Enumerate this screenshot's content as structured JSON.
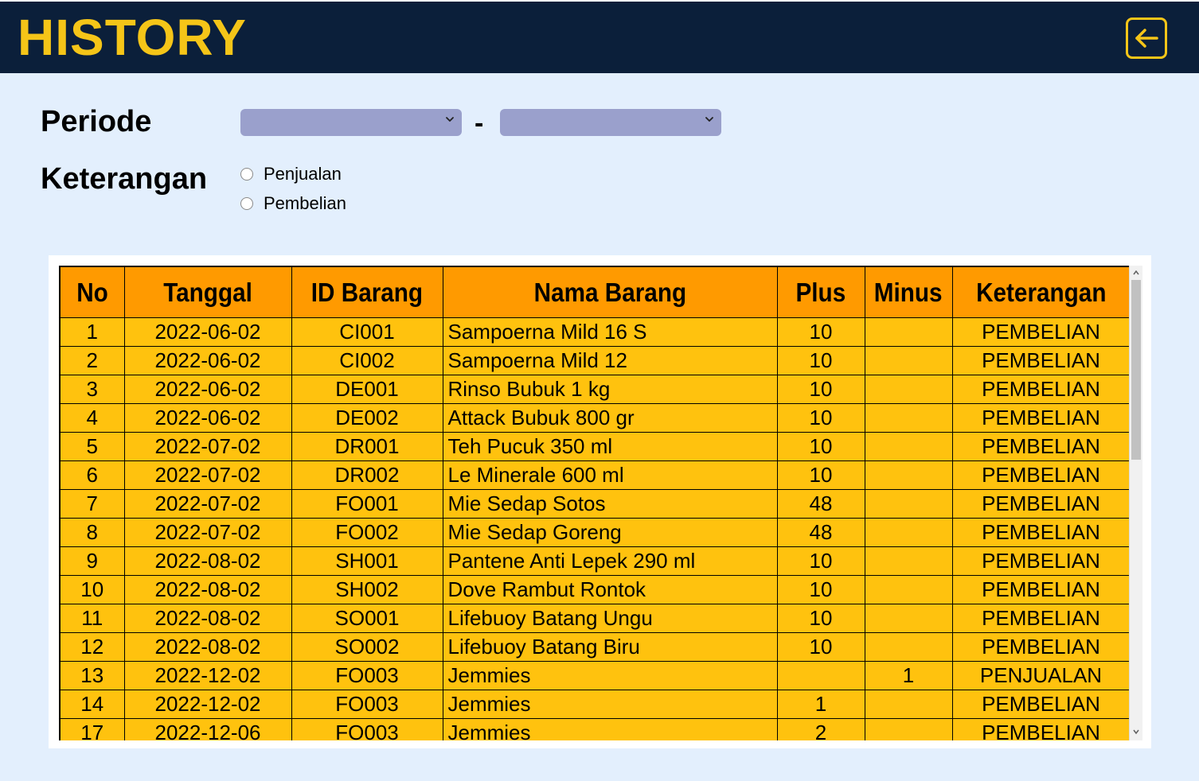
{
  "header": {
    "title": "HISTORY",
    "back_icon": "arrow-left-icon",
    "accent_color": "#f5c518",
    "background_color": "#0b1f3a"
  },
  "filters": {
    "periode_label": "Periode",
    "periode_start_value": "",
    "periode_separator": "-",
    "periode_end_value": "",
    "keterangan_label": "Keterangan",
    "keterangan_options": [
      "Penjualan",
      "Pembelian"
    ],
    "keterangan_selected": ""
  },
  "table": {
    "columns": [
      "No",
      "Tanggal",
      "ID Barang",
      "Nama Barang",
      "Plus",
      "Minus",
      "Keterangan"
    ],
    "rows": [
      [
        "1",
        "2022-06-02",
        "CI001",
        "Sampoerna Mild 16 S",
        "10",
        "",
        "PEMBELIAN"
      ],
      [
        "2",
        "2022-06-02",
        "CI002",
        "Sampoerna Mild 12",
        "10",
        "",
        "PEMBELIAN"
      ],
      [
        "3",
        "2022-06-02",
        "DE001",
        "Rinso Bubuk 1 kg",
        "10",
        "",
        "PEMBELIAN"
      ],
      [
        "4",
        "2022-06-02",
        "DE002",
        "Attack Bubuk 800 gr",
        "10",
        "",
        "PEMBELIAN"
      ],
      [
        "5",
        "2022-07-02",
        "DR001",
        "Teh Pucuk 350 ml",
        "10",
        "",
        "PEMBELIAN"
      ],
      [
        "6",
        "2022-07-02",
        "DR002",
        "Le Minerale 600 ml",
        "10",
        "",
        "PEMBELIAN"
      ],
      [
        "7",
        "2022-07-02",
        "FO001",
        "Mie Sedap Sotos",
        "48",
        "",
        "PEMBELIAN"
      ],
      [
        "8",
        "2022-07-02",
        "FO002",
        "Mie Sedap Goreng",
        "48",
        "",
        "PEMBELIAN"
      ],
      [
        "9",
        "2022-08-02",
        "SH001",
        "Pantene Anti Lepek 290 ml",
        "10",
        "",
        "PEMBELIAN"
      ],
      [
        "10",
        "2022-08-02",
        "SH002",
        "Dove Rambut Rontok",
        "10",
        "",
        "PEMBELIAN"
      ],
      [
        "11",
        "2022-08-02",
        "SO001",
        "Lifebuoy Batang Ungu",
        "10",
        "",
        "PEMBELIAN"
      ],
      [
        "12",
        "2022-08-02",
        "SO002",
        "Lifebuoy Batang Biru",
        "10",
        "",
        "PEMBELIAN"
      ],
      [
        "13",
        "2022-12-02",
        "FO003",
        "Jemmies",
        "",
        "1",
        "PENJUALAN"
      ],
      [
        "14",
        "2022-12-02",
        "FO003",
        "Jemmies",
        "1",
        "",
        "PEMBELIAN"
      ],
      [
        "17",
        "2022-12-06",
        "FO003",
        "Jemmies",
        "2",
        "",
        "PEMBELIAN"
      ]
    ],
    "header_color": "#ff9a00",
    "row_color": "#ffc20e"
  },
  "scrollbar": {
    "up_icon": "chevron-up-icon",
    "down_icon": "chevron-down-icon"
  }
}
